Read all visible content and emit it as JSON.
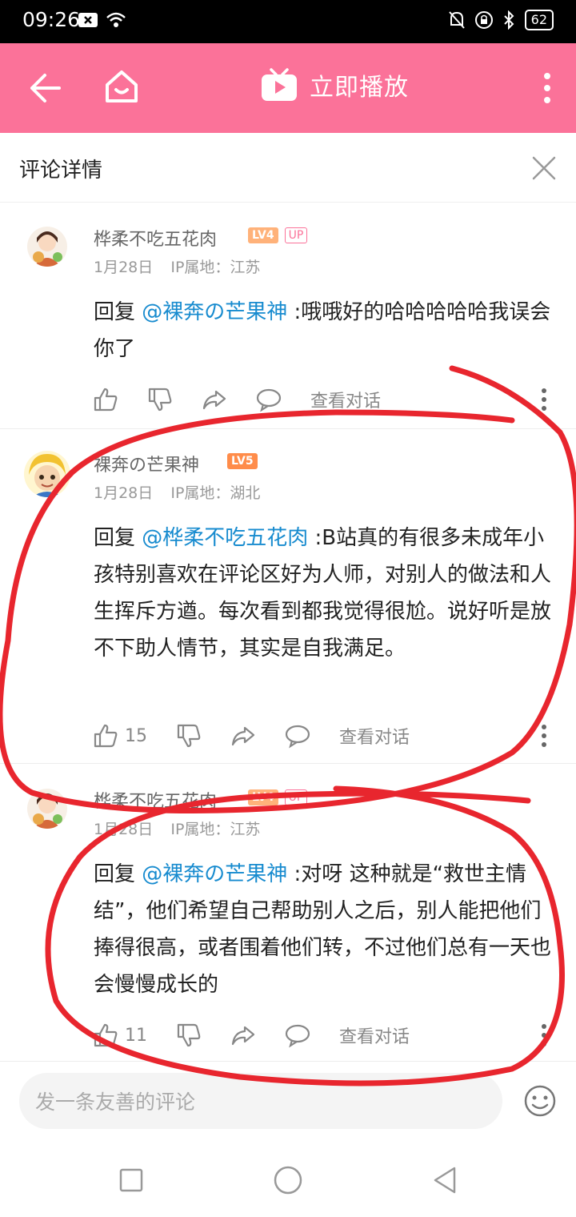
{
  "status_bar": {
    "time": "09:26",
    "battery": "62",
    "icons": [
      "notification-close-icon",
      "wifi-icon",
      "mute-icon",
      "lock-icon",
      "bluetooth-icon",
      "battery-icon"
    ]
  },
  "header": {
    "title": "立即播放",
    "icons": [
      "back-arrow-icon",
      "home-icon",
      "tv-play-icon",
      "more-vertical-icon"
    ],
    "color": "#fb7299"
  },
  "page": {
    "title": "评论详情",
    "close_icon": "close-icon"
  },
  "comments": [
    {
      "user": "桦柔不吃五花肉",
      "level": "LV4",
      "up_badge": "UP",
      "date": "1月28日",
      "ip": "IP属地：江苏",
      "reply_prefix": "回复 ",
      "mention": "@裸奔の芒果神",
      "text": " :哦哦好的哈哈哈哈哈我误会你了",
      "likes": "",
      "view_conversation": "查看对话"
    },
    {
      "user": "裸奔の芒果神",
      "level": "LV5",
      "up_badge": "",
      "date": "1月28日",
      "ip": "IP属地：湖北",
      "reply_prefix": "回复 ",
      "mention": "@桦柔不吃五花肉",
      "text": " :B站真的有很多未成年小孩特别喜欢在评论区好为人师，对别人的做法和人生挥斥方遒。每次看到都我觉得很尬。说好听是放不下助人情节，其实是自我满足。",
      "likes": "15",
      "view_conversation": "查看对话"
    },
    {
      "user": "桦柔不吃五花肉",
      "level": "LV4",
      "up_badge": "UP",
      "date": "1月28日",
      "ip": "IP属地：江苏",
      "reply_prefix": "回复 ",
      "mention": "@裸奔の芒果神",
      "text": " :对呀 这种就是“救世主情结”，他们希望自己帮助别人之后，别人能把他们捧得很高，或者围着他们转，不过他们总有一天也会慢慢成长的",
      "likes": "11",
      "view_conversation": "查看对话"
    }
  ],
  "composer": {
    "placeholder": "发一条友善的评论",
    "value": ""
  },
  "annotation_color": "#e8262e"
}
